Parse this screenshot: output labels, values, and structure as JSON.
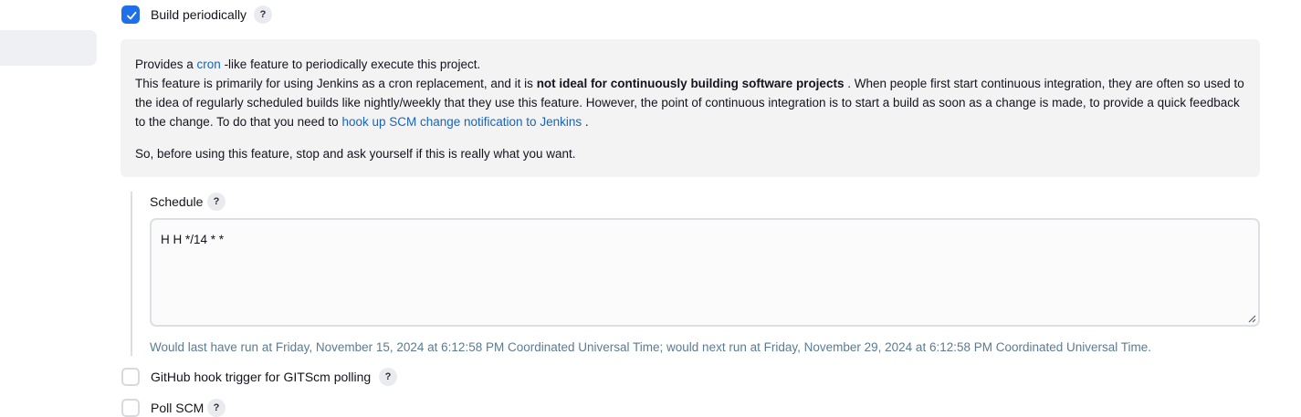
{
  "build_periodically": {
    "label": "Build periodically",
    "checked": true,
    "help_icon": "?"
  },
  "help": {
    "p1_prefix": "Provides a ",
    "p1_link": "cron",
    "p1_suffix": " -like feature to periodically execute this project.",
    "p2_part1": "This feature is primarily for using Jenkins as a cron replacement, and it is ",
    "p2_bold": "not ideal for continuously building software projects",
    "p2_part2": " . When people first start continuous integration, they are often so used to the idea of regularly scheduled builds like nightly/weekly that they use this feature. However, the point of continuous integration is to start a build as soon as a change is made, to provide a quick feedback to the change. To do that you need to ",
    "p2_link": "hook up SCM change notification to Jenkins",
    "p2_end": " .",
    "p3": "So, before using this feature, stop and ask yourself if this is really what you want."
  },
  "schedule": {
    "label": "Schedule",
    "help_icon": "?",
    "value": "H H */14 * *",
    "validation": "Would last have run at Friday, November 15, 2024 at 6:12:58 PM Coordinated Universal Time; would next run at Friday, November 29, 2024 at 6:12:58 PM Coordinated Universal Time."
  },
  "github_hook": {
    "label": "GitHub hook trigger for GITScm polling",
    "checked": false,
    "help_icon": "?"
  },
  "poll_scm": {
    "label": "Poll SCM",
    "checked": false,
    "help_icon": "?"
  },
  "colors": {
    "accent": "#1f6feb",
    "link": "#1565c0",
    "validation_text": "#5b7b94",
    "panel_bg": "#f3f3f3"
  }
}
